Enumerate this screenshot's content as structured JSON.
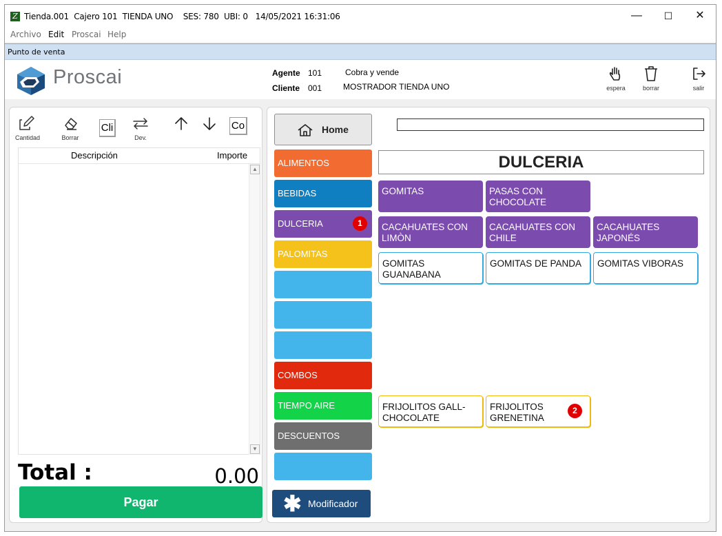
{
  "window": {
    "title": "Tienda.001  Cajero 101  TIENDA UNO    SES: 780  UBI: 0   14/05/2021 16:31:06",
    "app_icon": "Z",
    "controls": {
      "minimize": "—",
      "maximize": "☐",
      "close": "✕"
    }
  },
  "menu": {
    "items": [
      "Archivo",
      "Edit",
      "Proscai",
      "Help"
    ]
  },
  "subtitle": "Punto de venta",
  "header": {
    "logo_text": "Proscai",
    "agente_label": "Agente",
    "agente_value": "101",
    "agente_desc": "Cobra y vende",
    "cliente_label": "Cliente",
    "cliente_value": "001",
    "cliente_desc": "MOSTRADOR TIENDA UNO",
    "tools": {
      "espera": "espera",
      "borrar": "borrar",
      "salir": "salir"
    }
  },
  "left": {
    "tools": {
      "cantidad": "Cantidad",
      "borrar": "Borrar",
      "cli": "Cli",
      "dev": "Dev.",
      "co": "Co"
    },
    "columns": {
      "descripcion": "Descripción",
      "importe": "Importe"
    },
    "total_label": "Total :",
    "total_value": "0.00",
    "pay_label": "Pagar"
  },
  "right": {
    "home_label": "Home",
    "search_value": "",
    "section_title": "DULCERIA",
    "categories": [
      {
        "label": "ALIMENTOS",
        "color": "#f26c32"
      },
      {
        "label": "BEBIDAS",
        "color": "#0f7fc1"
      },
      {
        "label": "DULCERIA",
        "color": "#7b4bae",
        "badge": "1"
      },
      {
        "label": "PALOMITAS",
        "color": "#f5c11b"
      },
      {
        "label": "",
        "color": "#43b5ea"
      },
      {
        "label": "",
        "color": "#43b5ea"
      },
      {
        "label": "",
        "color": "#43b5ea"
      },
      {
        "label": "COMBOS",
        "color": "#e12a0d"
      },
      {
        "label": "TIEMPO AIRE",
        "color": "#13d449"
      },
      {
        "label": "DESCUENTOS",
        "color": "#6f6f6f"
      },
      {
        "label": "",
        "color": "#43b5ea"
      }
    ],
    "products": {
      "gomitas": "GOMITAS",
      "pasas": "PASAS CON CHOCOLATE",
      "cac_limon": "CACAHUATES CON LIMÒN",
      "cac_chile": "CACAHUATES CON CHILE",
      "cac_japones": "CACAHUATES JAPONÉS",
      "gom_guanabana": "GOMITAS GUANABANA",
      "gom_panda": "GOMITAS DE PANDA",
      "gom_viboras": "GOMITAS VIBORAS",
      "frij_choc": "FRIJOLITOS GALL-CHOCOLATE",
      "frij_gren": "FRIJOLITOS GRENETINA",
      "frij_gren_badge": "2"
    },
    "modificador_label": "Modificador"
  }
}
